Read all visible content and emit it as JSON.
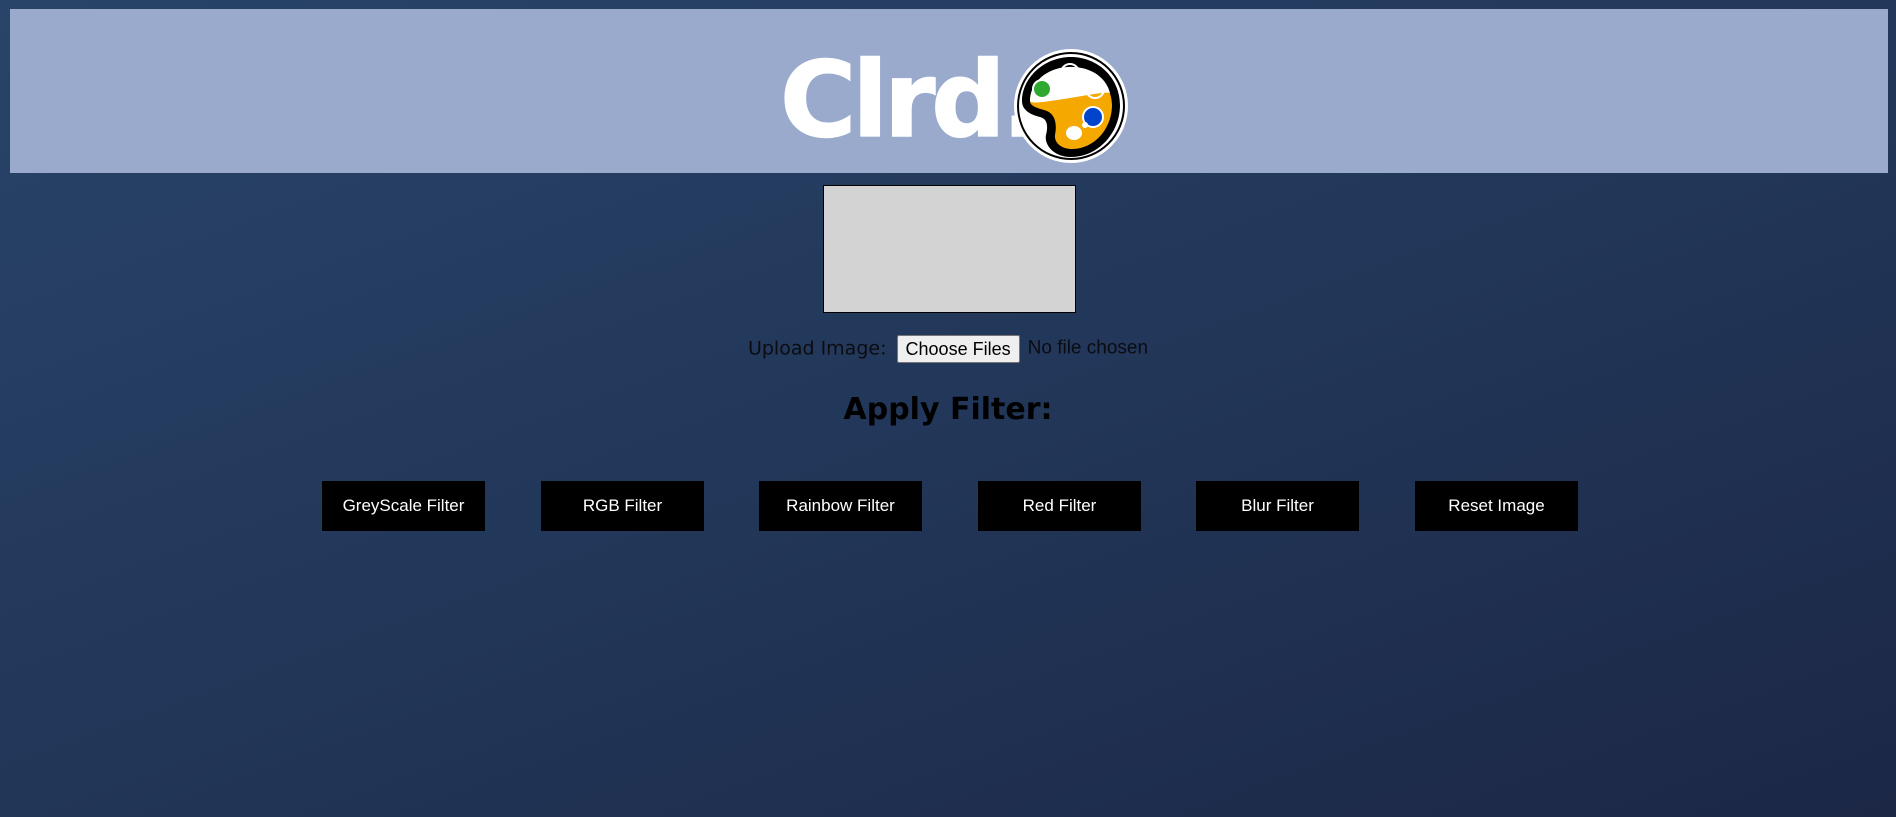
{
  "header": {
    "logo_text": "Clrd.",
    "logo_icon": "artist-palette-icon",
    "colors": {
      "header_bg": "#9aaacd",
      "palette_yellow": "#f5a800",
      "palette_blue": "#0044cc",
      "palette_green": "#2fa82f"
    }
  },
  "canvas": {
    "background": "#d3d3d3"
  },
  "upload": {
    "label": "Upload Image:",
    "button_label": "Choose Files",
    "status_text": "No file chosen"
  },
  "filters": {
    "heading": "Apply Filter:",
    "buttons": [
      {
        "label": "GreyScale Filter"
      },
      {
        "label": "RGB Filter"
      },
      {
        "label": "Rainbow Filter"
      },
      {
        "label": "Red Filter"
      },
      {
        "label": "Blur Filter"
      },
      {
        "label": "Reset Image"
      }
    ]
  }
}
